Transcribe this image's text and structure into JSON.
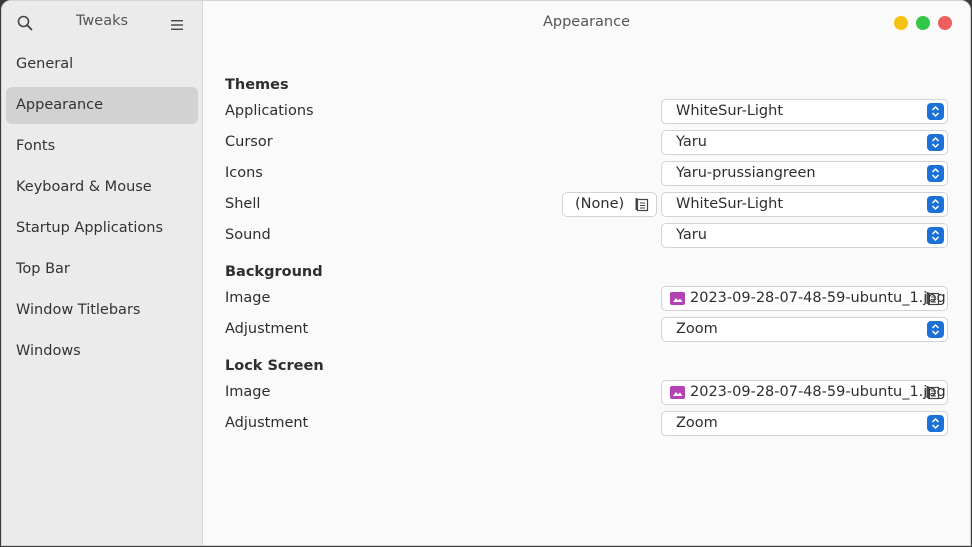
{
  "sidebar": {
    "title": "Tweaks",
    "items": [
      {
        "label": "General"
      },
      {
        "label": "Appearance"
      },
      {
        "label": "Fonts"
      },
      {
        "label": "Keyboard & Mouse"
      },
      {
        "label": "Startup Applications"
      },
      {
        "label": "Top Bar"
      },
      {
        "label": "Window Titlebars"
      },
      {
        "label": "Windows"
      }
    ],
    "active_item": "Appearance",
    "icons": [
      "search-icon",
      "hamburger-menu-icon"
    ]
  },
  "header": {
    "title": "Appearance",
    "window_controls": [
      "minimize",
      "maximize",
      "close"
    ]
  },
  "themes": {
    "heading": "Themes",
    "applications": {
      "label": "Applications",
      "value": "WhiteSur-Light"
    },
    "cursor": {
      "label": "Cursor",
      "value": "Yaru"
    },
    "icons": {
      "label": "Icons",
      "value": "Yaru-prussiangreen"
    },
    "shell": {
      "label": "Shell",
      "file_button": "(None)",
      "value": "WhiteSur-Light"
    },
    "sound": {
      "label": "Sound",
      "value": "Yaru"
    }
  },
  "background": {
    "heading": "Background",
    "image": {
      "label": "Image",
      "value": "2023-09-28-07-48-59-ubuntu_1.jpg"
    },
    "adjustment": {
      "label": "Adjustment",
      "value": "Zoom"
    }
  },
  "lock_screen": {
    "heading": "Lock Screen",
    "image": {
      "label": "Image",
      "value": "2023-09-28-07-48-59-ubuntu_1.jpg"
    },
    "adjustment": {
      "label": "Adjustment",
      "value": "Zoom"
    }
  },
  "colors": {
    "accent": "#1c71d8",
    "sidebar_bg": "#ebebeb",
    "active_item_bg": "#d2d2d2",
    "minimize": "#f5c211",
    "maximize": "#33c748",
    "close": "#ed5e5e",
    "image_icon": "#b542b5"
  }
}
